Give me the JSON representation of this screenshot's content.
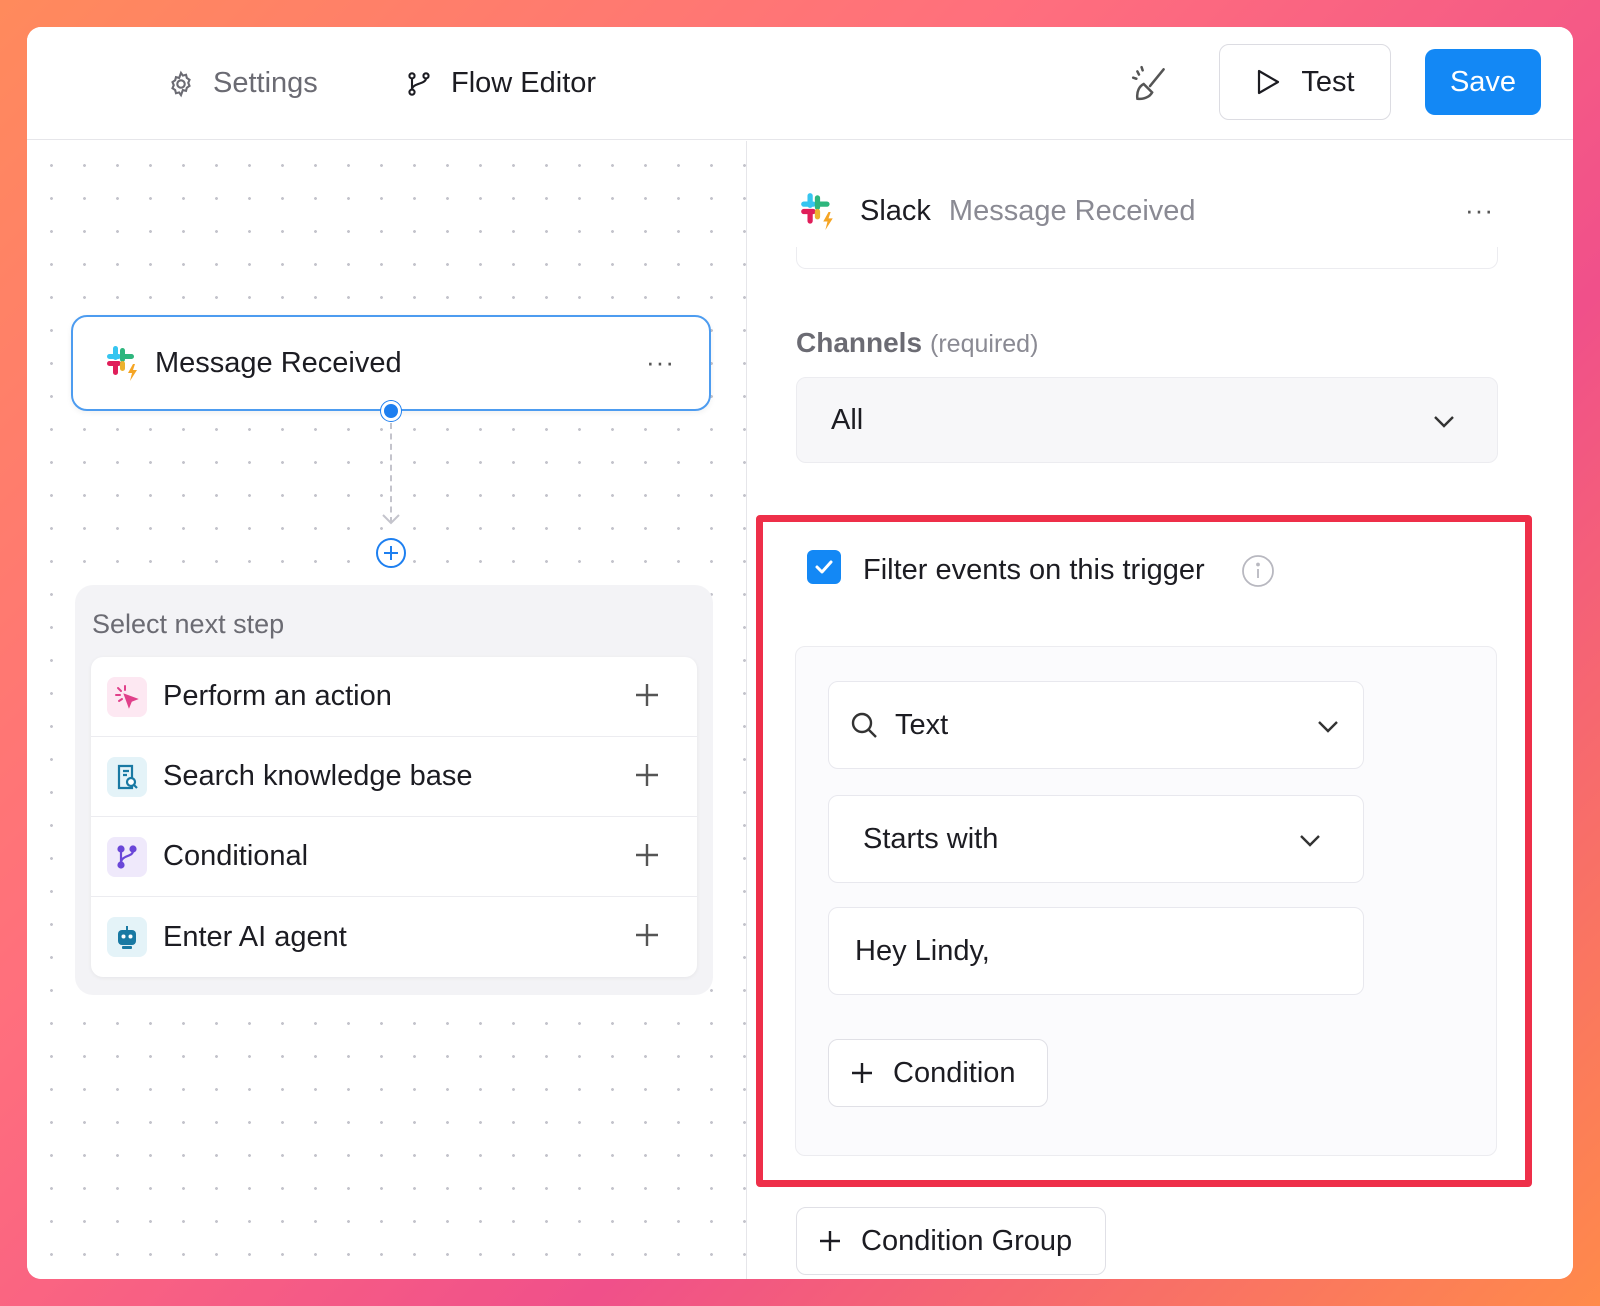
{
  "header": {
    "tabs": [
      {
        "label": "Settings",
        "icon": "gear-icon"
      },
      {
        "label": "Flow Editor",
        "icon": "git-branch-icon"
      }
    ],
    "test_label": "Test",
    "save_label": "Save",
    "accent_color": "#1388f5"
  },
  "canvas": {
    "trigger_node": {
      "title": "Message Received",
      "icon": "slack-icon",
      "more": "···"
    },
    "next_step": {
      "label": "Select next step",
      "items": [
        {
          "label": "Perform an action",
          "icon": "cursor-click-icon"
        },
        {
          "label": "Search knowledge base",
          "icon": "knowledge-base-icon"
        },
        {
          "label": "Conditional",
          "icon": "branch-icon"
        },
        {
          "label": "Enter AI agent",
          "icon": "robot-icon"
        }
      ]
    }
  },
  "panel": {
    "app": "Slack",
    "event": "Message Received",
    "more": "···",
    "channels_label": "Channels",
    "channels_required": "(required)",
    "channels_value": "All",
    "filter": {
      "title": "Filter events on this trigger",
      "checked": true,
      "highlight_color": "#ee2f49",
      "field_value": "Text",
      "operator_value": "Starts with",
      "input_value": "Hey Lindy,",
      "add_condition_label": "Condition"
    },
    "add_group_label": "Condition Group"
  }
}
